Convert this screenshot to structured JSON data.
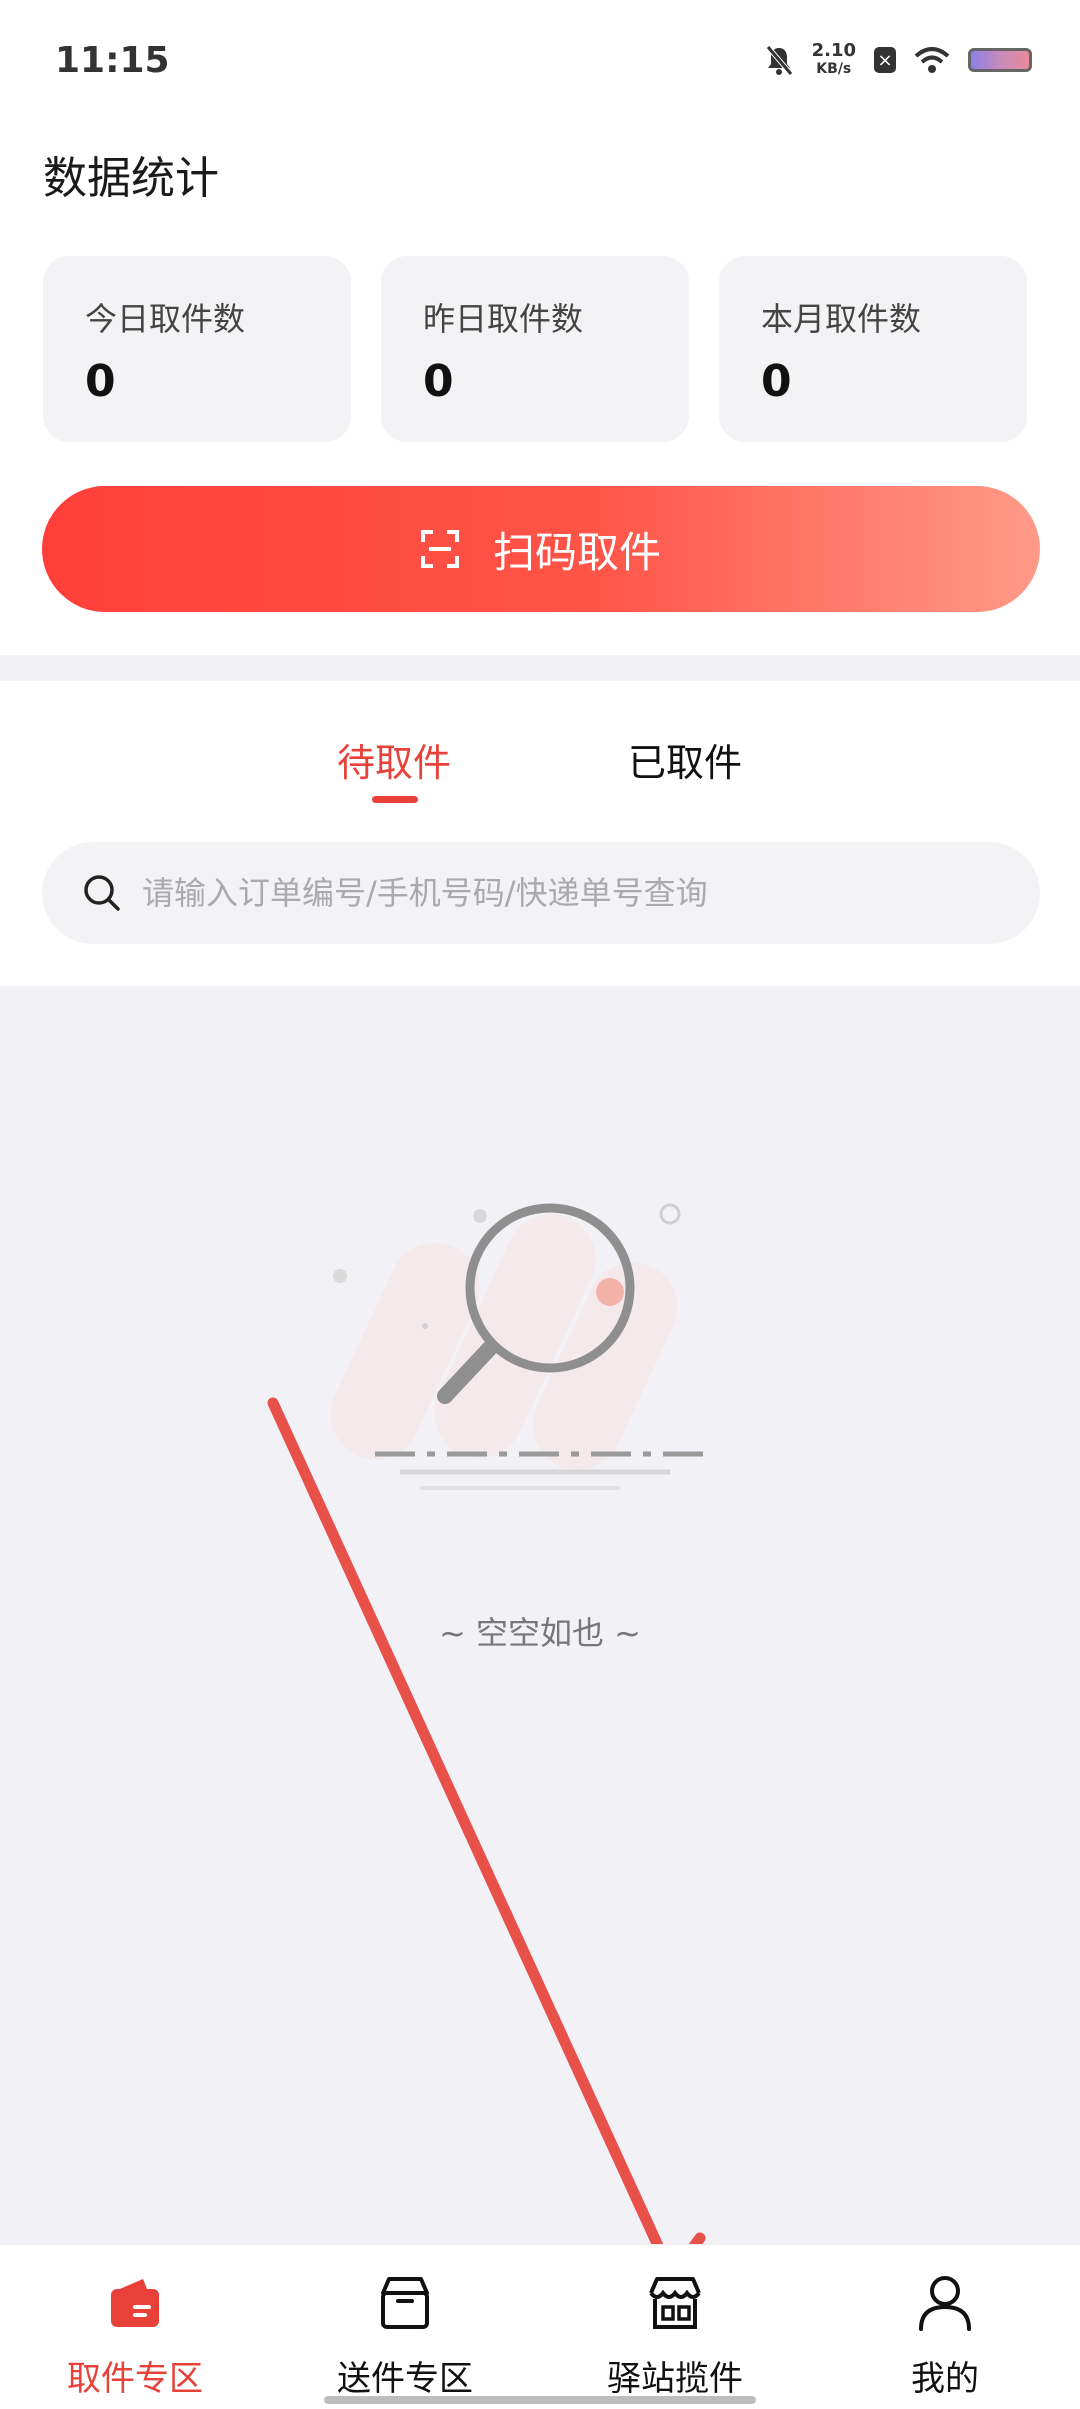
{
  "status_bar": {
    "time": "11:15",
    "net_speed_value": "2.10",
    "net_speed_unit": "KB/s"
  },
  "stats": {
    "title": "数据统计",
    "cards": [
      {
        "label": "今日取件数",
        "value": "0"
      },
      {
        "label": "昨日取件数",
        "value": "0"
      },
      {
        "label": "本月取件数",
        "value": "0"
      }
    ]
  },
  "scan_button": {
    "label": "扫码取件"
  },
  "tabs": [
    {
      "label": "待取件",
      "active": true
    },
    {
      "label": "已取件",
      "active": false
    }
  ],
  "search": {
    "placeholder": "请输入订单编号/手机号码/快递单号查询",
    "value": ""
  },
  "empty_state": {
    "text": "~ 空空如也 ~"
  },
  "bottom_nav": {
    "items": [
      {
        "label": "取件专区",
        "icon": "wallet-icon",
        "active": true
      },
      {
        "label": "送件专区",
        "icon": "box-icon",
        "active": false
      },
      {
        "label": "驿站揽件",
        "icon": "store-icon",
        "active": false
      },
      {
        "label": "我的",
        "icon": "user-icon",
        "active": false
      }
    ]
  },
  "colors": {
    "accent": "#e8413a",
    "button_gradient_start": "#ff3f3a",
    "button_gradient_end": "#ff9a88",
    "annotation_arrow": "#e8504a"
  }
}
